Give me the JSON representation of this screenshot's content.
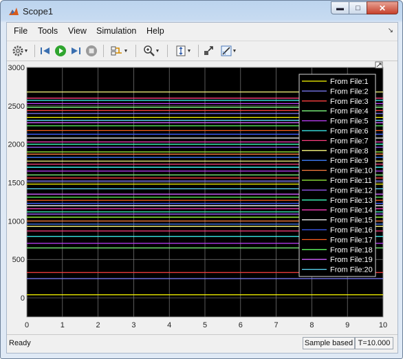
{
  "window": {
    "title": "Scope1"
  },
  "menu": [
    "File",
    "Tools",
    "View",
    "Simulation",
    "Help"
  ],
  "toolbar_icons": [
    "gear-icon",
    "step-back-icon",
    "run-icon",
    "step-forward-icon",
    "stop-icon",
    "signal-select-icon",
    "zoom-in-icon",
    "autoscale-icon",
    "highlight-block-icon",
    "measure-icon"
  ],
  "status": {
    "left": "Ready",
    "mode": "Sample based",
    "time": "T=10.000"
  },
  "chart_data": {
    "type": "line",
    "title": "",
    "xlabel": "",
    "ylabel": "",
    "xlim": [
      0,
      10
    ],
    "ylim": [
      -250,
      3000
    ],
    "xticks": [
      "0",
      "1",
      "2",
      "3",
      "4",
      "5",
      "6",
      "7",
      "8",
      "9",
      "10"
    ],
    "yticks": [
      "0",
      "500",
      "1000",
      "1500",
      "2000",
      "2500",
      "3000"
    ],
    "grid": true,
    "legend_position": "top-right",
    "background": "#000000",
    "grid_color": "#808080",
    "legend": [
      {
        "name": "From File:1",
        "color": "#ffff00"
      },
      {
        "name": "From File:2",
        "color": "#8080ff"
      },
      {
        "name": "From File:3",
        "color": "#ff4040"
      },
      {
        "name": "From File:4",
        "color": "#80ff80"
      },
      {
        "name": "From File:5",
        "color": "#c040ff"
      },
      {
        "name": "From File:6",
        "color": "#40ffff"
      },
      {
        "name": "From File:7",
        "color": "#ff4080"
      },
      {
        "name": "From File:8",
        "color": "#ffff80"
      },
      {
        "name": "From File:9",
        "color": "#4080ff"
      },
      {
        "name": "From File:10",
        "color": "#ff8040"
      },
      {
        "name": "From File:11",
        "color": "#a0ff40"
      },
      {
        "name": "From File:12",
        "color": "#a060ff"
      },
      {
        "name": "From File:13",
        "color": "#40ffc0"
      },
      {
        "name": "From File:14",
        "color": "#ff40c0"
      },
      {
        "name": "From File:15",
        "color": "#ffffff"
      },
      {
        "name": "From File:16",
        "color": "#4060ff"
      },
      {
        "name": "From File:17",
        "color": "#ff6020"
      },
      {
        "name": "From File:18",
        "color": "#60ff60"
      },
      {
        "name": "From File:19",
        "color": "#d060ff"
      },
      {
        "name": "From File:20",
        "color": "#60e0ff"
      }
    ],
    "line_values": [
      40,
      250,
      330,
      650,
      710,
      800,
      870,
      930,
      960,
      1000,
      1050,
      1090,
      1120,
      1160,
      1200,
      1230,
      1270,
      1310,
      1350,
      1420,
      1480,
      1520,
      1560,
      1600,
      1650,
      1700,
      1740,
      1780,
      1830,
      1870,
      1900,
      1960,
      2000,
      2030,
      2080,
      2130,
      2180,
      2240,
      2280,
      2310,
      2350,
      2400,
      2440,
      2480,
      2530,
      2570,
      2600,
      2680
    ]
  }
}
